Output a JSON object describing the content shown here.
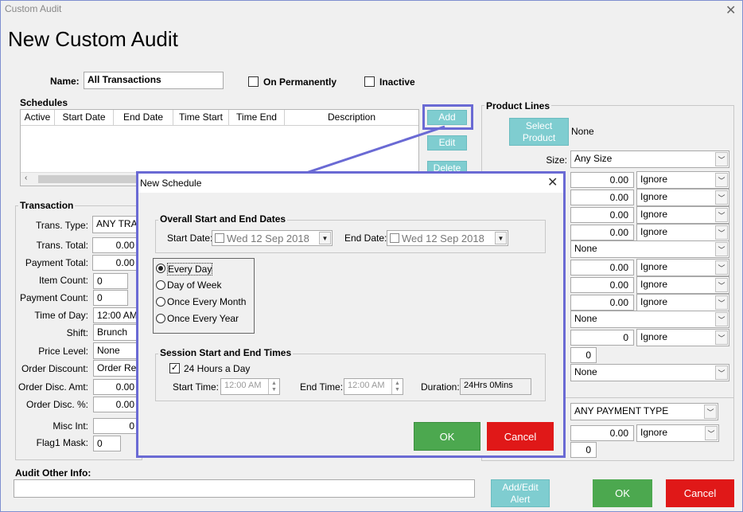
{
  "window": {
    "title": "Custom Audit",
    "heading": "New Custom Audit"
  },
  "name_row": {
    "label": "Name:",
    "value": "All Transactions",
    "on_permanently": "On Permanently",
    "inactive": "Inactive"
  },
  "schedules": {
    "title": "Schedules",
    "columns": [
      "Active",
      "Start Date",
      "End Date",
      "Time Start",
      "Time End",
      "Description"
    ],
    "add": "Add",
    "edit": "Edit",
    "delete": "Delete"
  },
  "transaction": {
    "title": "Transaction",
    "trans_type_label": "Trans. Type:",
    "trans_type_value": "ANY TRAN",
    "trans_total_label": "Trans. Total:",
    "trans_total_value": "0.00",
    "payment_total_label": "Payment Total:",
    "payment_total_value": "0.00",
    "item_count_label": "Item Count:",
    "item_count_value": "0",
    "payment_count_label": "Payment Count:",
    "payment_count_value": "0",
    "time_of_day_label": "Time of Day:",
    "time_of_day_value": "12:00 AM",
    "shift_label": "Shift:",
    "shift_value": "Brunch",
    "price_level_label": "Price Level:",
    "price_level_value": "None",
    "order_discount_label": "Order Discount:",
    "order_discount_value": "Order Rep",
    "order_disc_amt_label": "Order Disc. Amt:",
    "order_disc_amt_value": "0.00",
    "order_disc_pct_label": "Order Disc. %:",
    "order_disc_pct_value": "0.00",
    "misc_int_label": "Misc Int:",
    "misc_int_value": "0",
    "flag1_mask_label": "Flag1 Mask:",
    "flag1_mask_value": "0"
  },
  "product_lines": {
    "title": "Product Lines",
    "select_product": "Select Product",
    "none_text": "None",
    "size_label": "Size:",
    "size_value": "Any Size",
    "rows": [
      {
        "value": "0.00",
        "mode": "Ignore"
      },
      {
        "value": "0.00",
        "mode": "Ignore"
      },
      {
        "value": "0.00",
        "mode": "Ignore"
      },
      {
        "value": "0.00",
        "mode": "Ignore"
      }
    ],
    "none_select": "None",
    "rows2": [
      {
        "value": "0.00",
        "mode": "Ignore"
      },
      {
        "value": "0.00",
        "mode": "Ignore"
      },
      {
        "value": "0.00",
        "mode": "Ignore"
      }
    ],
    "none_select2": "None",
    "int_value": "0",
    "int_mode": "Ignore",
    "zero_value": "0",
    "none_select3": "None",
    "payment_type": "ANY PAYMENT TYPE",
    "payment_value": "0.00",
    "payment_mode": "Ignore",
    "payment_zero": "0"
  },
  "audit_other_info": {
    "label": "Audit Other Info:",
    "value": ""
  },
  "bottom": {
    "add_edit_alert": "Add/Edit Alert",
    "ok": "OK",
    "cancel": "Cancel"
  },
  "dialog": {
    "title": "New Schedule",
    "dates_title": "Overall Start and End Dates",
    "start_date_label": "Start Date:",
    "start_date_value": "Wed 12 Sep 2018",
    "end_date_label": "End Date:",
    "end_date_value": "Wed 12 Sep 2018",
    "freq": [
      "Every Day",
      "Day of Week",
      "Once Every Month",
      "Once Every Year"
    ],
    "session_title": "Session Start and End Times",
    "hours24": "24 Hours a Day",
    "start_time_label": "Start Time:",
    "start_time_value": "12:00 AM",
    "end_time_label": "End Time:",
    "end_time_value": "12:00 AM",
    "duration_label": "Duration:",
    "duration_value": "24Hrs 0Mins",
    "ok": "OK",
    "cancel": "Cancel"
  },
  "colors": {
    "accent_teal": "#7fcdd0",
    "ok_green": "#4ca84f",
    "cancel_red": "#e01818",
    "highlight": "#6a6ad4"
  }
}
